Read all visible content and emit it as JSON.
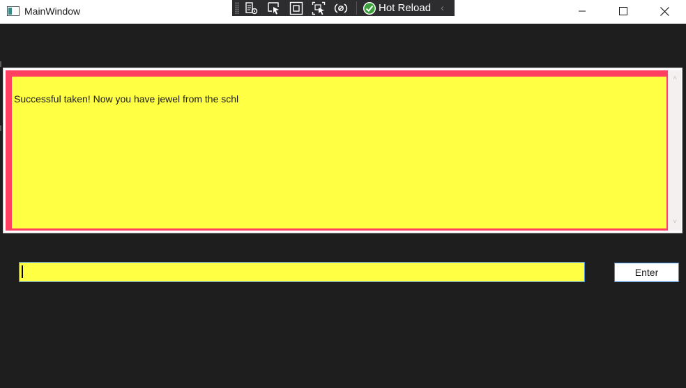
{
  "window": {
    "title": "MainWindow"
  },
  "debug_toolbar": {
    "hot_reload_label": "Hot Reload",
    "icons": [
      "live-visual-tree-icon",
      "select-element-icon",
      "display-layout-adorners-icon",
      "track-focus-icon",
      "binding-failures-icon",
      "hot-reload-check-icon",
      "collapse-chevron-icon"
    ]
  },
  "output": {
    "text": "Successful taken! Now you have jewel from the schl"
  },
  "command": {
    "input_value": "",
    "enter_label": "Enter"
  },
  "colors": {
    "background": "#1e1e1e",
    "output_border": "#ff4060",
    "output_fill": "#ffff44",
    "input_fill": "#ffff44",
    "focus_border": "#4a90e2"
  }
}
